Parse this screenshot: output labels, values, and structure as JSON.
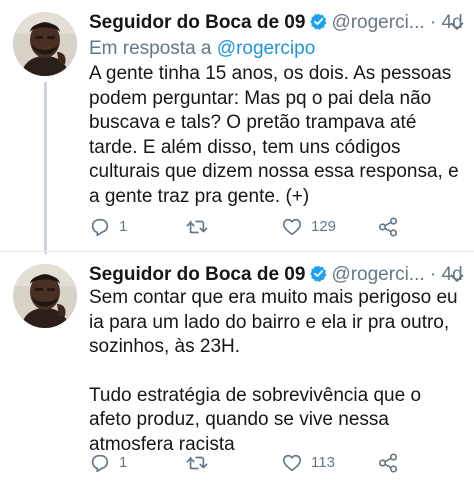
{
  "tweets": [
    {
      "display_name": "Seguidor do Boca de 09",
      "handle": "@rogerci...",
      "separator": "·",
      "time": "4d",
      "reply_prefix": "Em resposta a",
      "reply_handle": "@rogercipo",
      "paragraphs": [
        "A gente tinha 15 anos, os dois. As pessoas podem perguntar: Mas pq o pai dela não buscava e tals? O pretão trampava até tarde. E além disso, tem uns códigos culturais que dizem nossa essa responsa, e a gente traz pra gente. (+)"
      ],
      "reply_count": "1",
      "retweet_count": "",
      "like_count": "129"
    },
    {
      "display_name": "Seguidor do Boca de 09",
      "handle": "@rogerci...",
      "separator": "·",
      "time": "4d",
      "paragraphs": [
        "Sem contar que era muito mais perigoso eu ia para um lado do bairro e ela ir pra outro, sozinhos, às 23H.",
        "Tudo estratégia de sobrevivência que o afeto produz, quando se vive nessa atmosfera racista"
      ],
      "reply_count": "1",
      "retweet_count": "",
      "like_count": "113"
    }
  ],
  "icons": {
    "verified": "verified-badge-icon",
    "caret": "chevron-down-icon",
    "reply": "reply-icon",
    "retweet": "retweet-icon",
    "like": "heart-icon",
    "share": "share-icon"
  },
  "colors": {
    "link": "#1b95e0",
    "secondary_text": "#657786",
    "verified": "#1da1f2",
    "thread_line": "#ccd6dd"
  }
}
